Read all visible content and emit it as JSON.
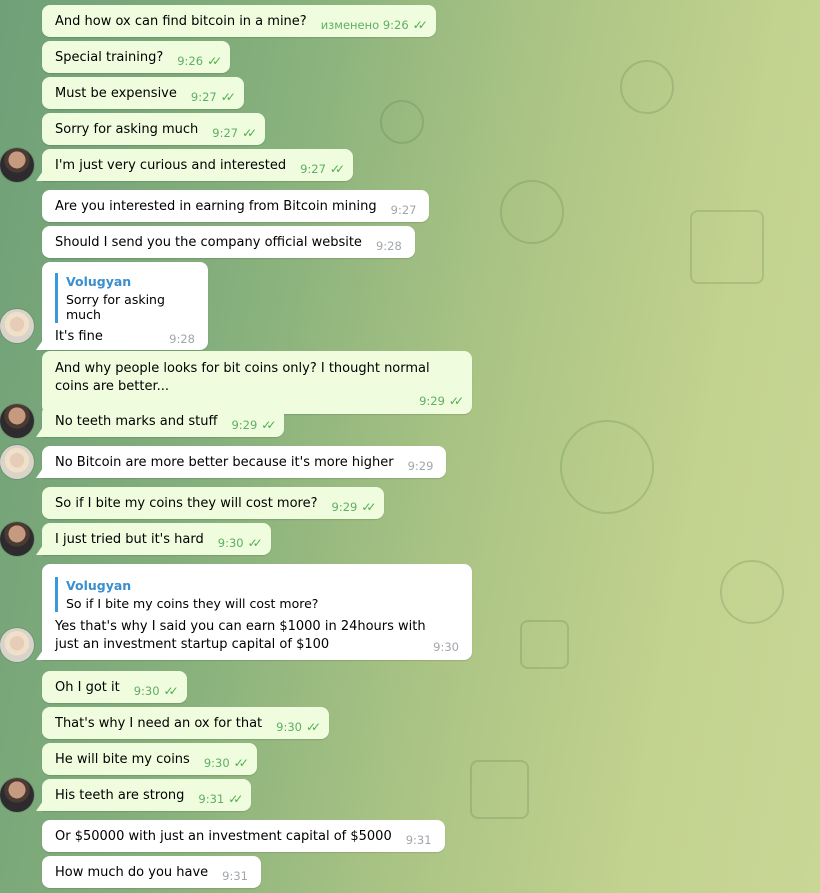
{
  "messages": [
    {
      "text": "And how ox can find bitcoin in a mine?",
      "meta": "изменено 9:26",
      "ticks": "✓✓"
    },
    {
      "text": "Special training?",
      "meta": "9:26",
      "ticks": "✓✓"
    },
    {
      "text": "Must be expensive",
      "meta": "9:27",
      "ticks": "✓✓"
    },
    {
      "text": "Sorry for asking much",
      "meta": "9:27",
      "ticks": "✓✓"
    },
    {
      "text": "I'm just very curious and interested",
      "meta": "9:27",
      "ticks": "✓✓"
    },
    {
      "text": "Are you interested in earning from Bitcoin mining",
      "meta": "9:27"
    },
    {
      "text": "Should I send you the company official website",
      "meta": "9:28"
    },
    {
      "reply_name": "Volugyan",
      "reply_text": "Sorry for asking much",
      "text": "It's fine",
      "meta": "9:28"
    },
    {
      "text": "And why people looks for bit coins only? I thought normal coins are better...",
      "meta": "9:29",
      "ticks": "✓✓"
    },
    {
      "text": "No teeth marks and stuff",
      "meta": "9:29",
      "ticks": "✓✓"
    },
    {
      "text": "No Bitcoin are more better because it's more higher",
      "meta": "9:29"
    },
    {
      "text": "So if I bite my coins they will cost more?",
      "meta": "9:29",
      "ticks": "✓✓"
    },
    {
      "text": "I just tried but it's hard",
      "meta": "9:30",
      "ticks": "✓✓"
    },
    {
      "reply_name": "Volugyan",
      "reply_text": "So if I bite my coins they will cost more?",
      "text": "Yes that's why I said you can earn $1000 in 24hours with just an investment startup capital of $100",
      "meta": "9:30"
    },
    {
      "text": "Oh I got it",
      "meta": "9:30",
      "ticks": "✓✓"
    },
    {
      "text": "That's why I need an ox for that",
      "meta": "9:30",
      "ticks": "✓✓"
    },
    {
      "text": "He will bite my coins",
      "meta": "9:30",
      "ticks": "✓✓"
    },
    {
      "text": "His teeth are strong",
      "meta": "9:31",
      "ticks": "✓✓"
    },
    {
      "text": "Or $50000 with just an investment capital of $5000",
      "meta": "9:31"
    },
    {
      "text": "How much do you have",
      "meta": "9:31"
    }
  ]
}
